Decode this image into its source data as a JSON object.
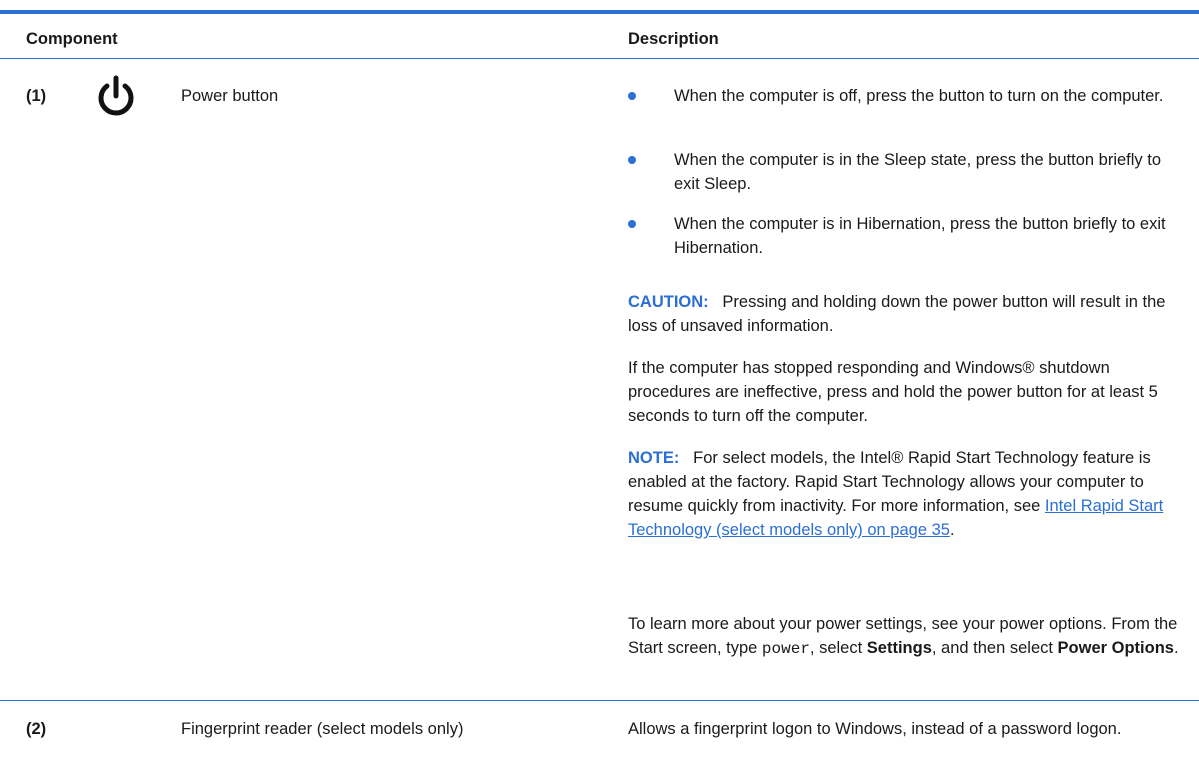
{
  "table": {
    "header": {
      "component": "Component",
      "description": "Description"
    },
    "rows": [
      {
        "number": "(1)",
        "icon": "power-icon",
        "name": "Power button",
        "bullets": [
          "When the computer is off, press the button to turn on the computer.",
          "When the computer is in the Sleep state, press the button briefly to exit Sleep.",
          "When the computer is in Hibernation, press the button briefly to exit Hibernation."
        ],
        "caution": {
          "label": "CAUTION:",
          "text": "Pressing and holding down the power button will result in the loss of unsaved information."
        },
        "stopped_text": "If the computer has stopped responding and Windows® shutdown procedures are ineffective, press and hold the power button for at least 5 seconds to turn off the computer.",
        "note": {
          "label": "NOTE:",
          "text": "For select models, the Intel® Rapid Start Technology feature is enabled at the factory. Rapid Start Technology allows your computer to resume quickly from inactivity. For more information, see ",
          "link": "Intel Rapid Start Technology (select models only) on page 35",
          "after": "."
        },
        "learn_more": {
          "part1": "To learn more about your power settings, see your power options. From the Start screen, type ",
          "code": "power",
          "part2": ", select ",
          "settings": "Settings",
          "part3": ", and then select ",
          "power_options": "Power Options",
          "part4": "."
        }
      },
      {
        "number": "(2)",
        "name": "Fingerprint reader (select models only)",
        "description": "Allows a fingerprint logon to Windows, instead of a password logon."
      }
    ]
  },
  "colors": {
    "accent": "#2b6fd6",
    "text": "#1a1a1a"
  }
}
